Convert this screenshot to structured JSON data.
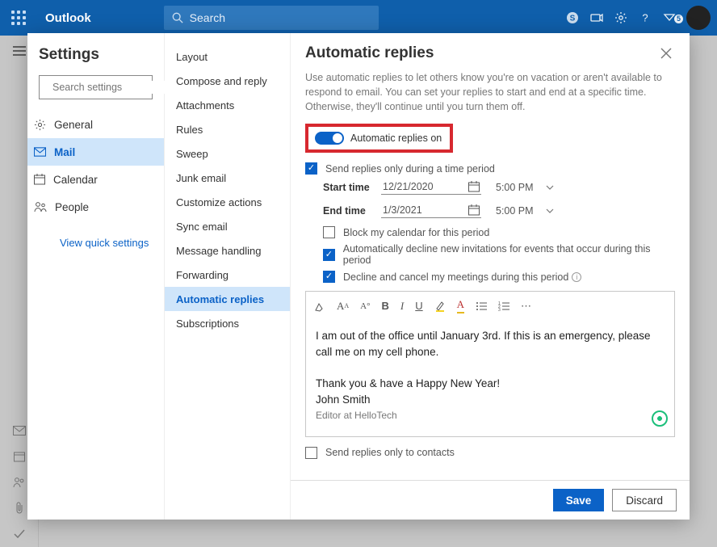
{
  "header": {
    "brand": "Outlook",
    "search_placeholder": "Search",
    "notification_count": "5"
  },
  "settings": {
    "title": "Settings",
    "search_placeholder": "Search settings",
    "nav": {
      "general": "General",
      "mail": "Mail",
      "calendar": "Calendar",
      "people": "People"
    },
    "view_quick": "View quick settings"
  },
  "mail_sub": {
    "items": [
      "Layout",
      "Compose and reply",
      "Attachments",
      "Rules",
      "Sweep",
      "Junk email",
      "Customize actions",
      "Sync email",
      "Message handling",
      "Forwarding",
      "Automatic replies",
      "Subscriptions"
    ]
  },
  "auto": {
    "title": "Automatic replies",
    "help": "Use automatic replies to let others know you're on vacation or aren't available to respond to email. You can set your replies to start and end at a specific time. Otherwise, they'll continue until you turn them off.",
    "toggle_label": "Automatic replies on",
    "only_period": "Send replies only during a time period",
    "start_label": "Start time",
    "end_label": "End time",
    "start_date": "12/21/2020",
    "end_date": "1/3/2021",
    "start_time": "5:00 PM",
    "end_time": "5:00 PM",
    "opt_block": "Block my calendar for this period",
    "opt_decline_new": "Automatically decline new invitations for events that occur during this period",
    "opt_cancel": "Decline and cancel my meetings during this period",
    "msg_line1": "I am out of the office until January 3rd. If this is an emergency, please call me on my cell phone.",
    "msg_line2": "Thank you & have a Happy New Year!",
    "msg_name": "John Smith",
    "msg_sig": "Editor at HelloTech",
    "only_contacts": "Send replies only to contacts",
    "save": "Save",
    "discard": "Discard"
  }
}
